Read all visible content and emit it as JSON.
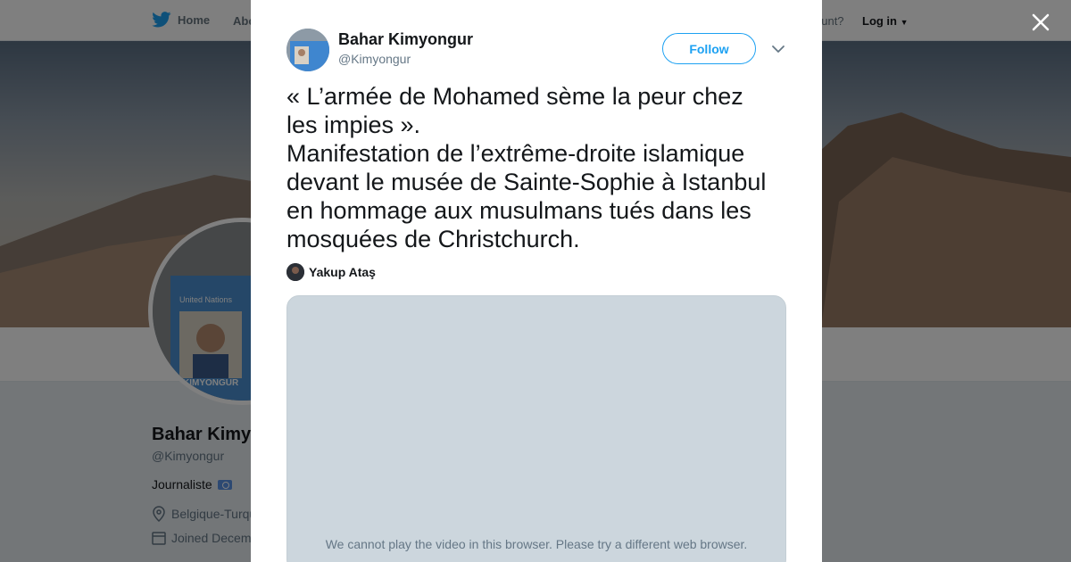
{
  "background": {
    "nav": {
      "home": "Home",
      "about": "Abo",
      "account": "ccount?",
      "login": "Log in"
    },
    "profile": {
      "name": "Bahar Kimy",
      "handle": "@Kimyongur",
      "bio": "Journaliste",
      "location": "Belgique-Turqu",
      "joined": "Joined Decem"
    },
    "id_card": {
      "org": "United Nations",
      "surname": "KIMYONGUR"
    }
  },
  "tweet": {
    "author_name": "Bahar Kimyongur",
    "author_handle": "@Kimyongur",
    "follow_label": "Follow",
    "text_lines": [
      "« L’armée de Mohamed sème la peur chez",
      "les impies ».",
      "Manifestation de l’extrême-droite islamique",
      "devant le musée de Sainte-Sophie à Istanbul",
      "en hommage aux musulmans tués dans les",
      "mosquées de Christchurch."
    ],
    "mention_name": "Yakup Ataş",
    "video_message": "We cannot play the video in this browser. Please try a different web browser."
  },
  "colors": {
    "accent": "#1da1f2",
    "text": "#14171a",
    "secondary_text": "#657786",
    "video_placeholder": "#ccd6dd",
    "overlay": "rgba(0,0,0,0.5)"
  },
  "icons": [
    "twitter-bird-icon",
    "close-icon",
    "chevron-down-icon",
    "location-icon",
    "calendar-icon",
    "caret-down-icon"
  ]
}
